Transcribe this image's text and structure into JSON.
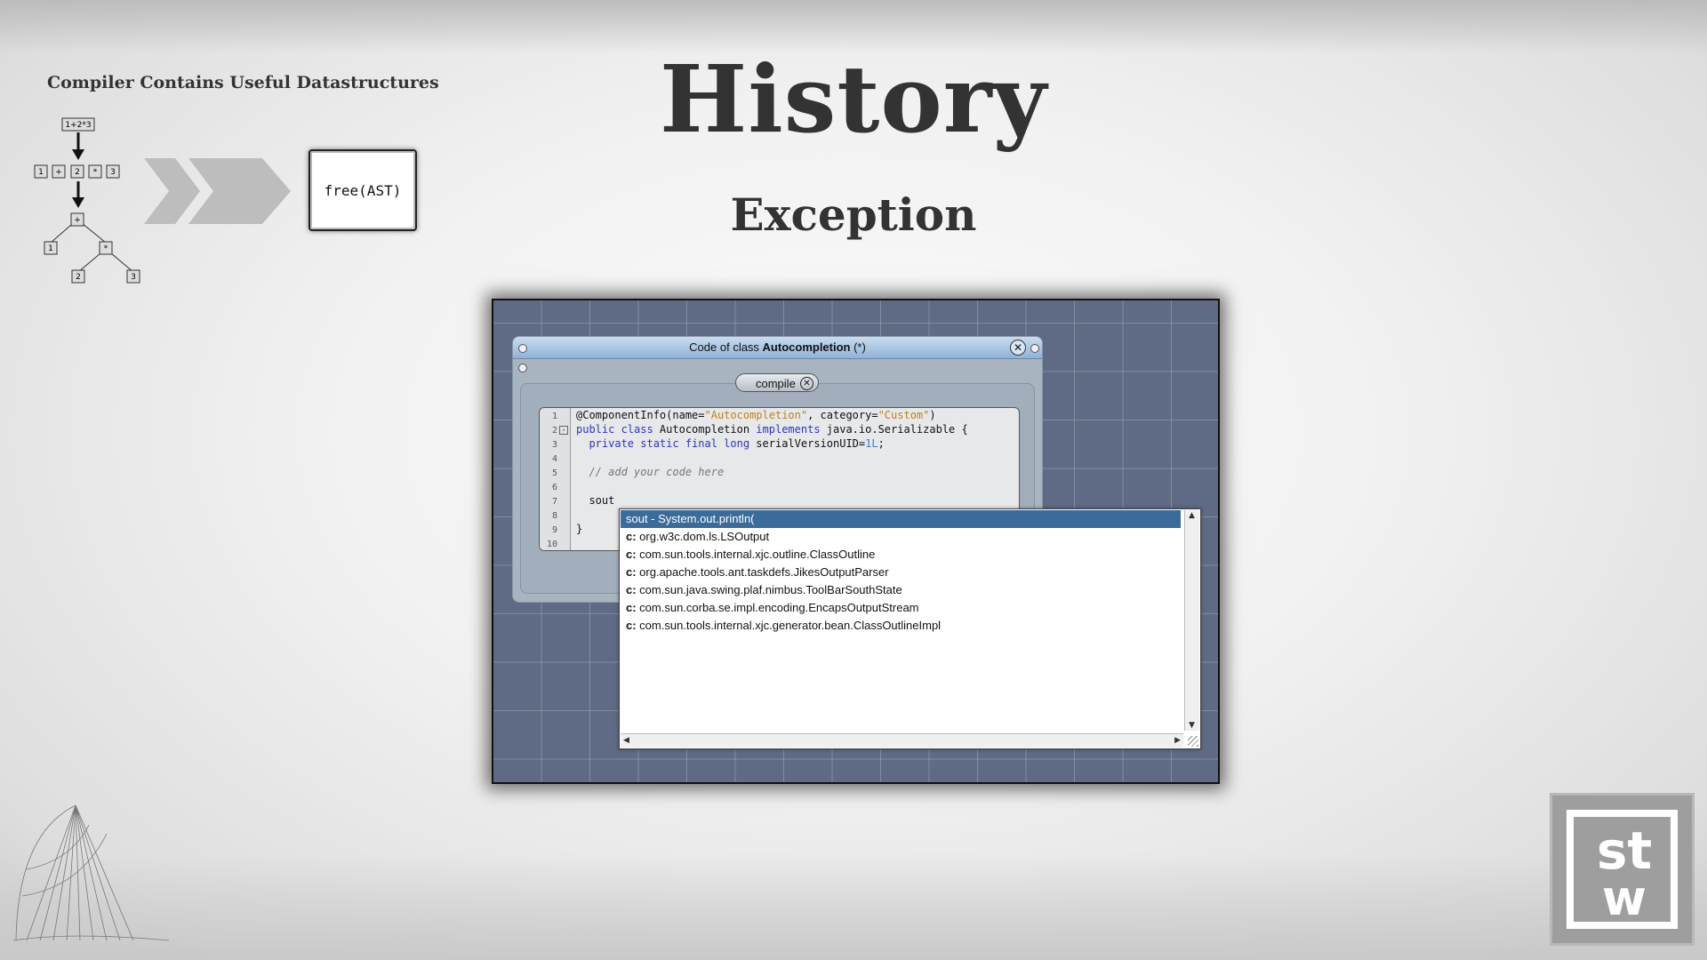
{
  "slide": {
    "title": "History",
    "subtitle": "Exception",
    "compiler": {
      "heading": "Compiler Contains Useful Datastructures",
      "expr": "1+2*3",
      "tokens": [
        "1",
        "+",
        "2",
        "*",
        "3"
      ],
      "tree": {
        "root": "+",
        "left": "1",
        "op": "*",
        "l2": "2",
        "r2": "3"
      },
      "result": "free(AST)"
    }
  },
  "window": {
    "title_prefix": "Code of class ",
    "title_class": "Autocompletion",
    "title_suffix": " (*)",
    "compile_label": "compile",
    "editor": {
      "line_numbers": [
        "1",
        "2",
        "3",
        "4",
        "5",
        "6",
        "7",
        "8",
        "9",
        "10"
      ],
      "lines": [
        "@ComponentInfo(name=\"Autocompletion\", category=\"Custom\")",
        "public class Autocompletion implements java.io.Serializable {",
        "  private static final long serialVersionUID=1L;",
        "",
        "  // add your code here",
        "",
        "  sout",
        "",
        "}",
        ""
      ]
    }
  },
  "autocomplete": {
    "items": [
      {
        "prefix": "",
        "text": "sout - System.out.println("
      },
      {
        "prefix": "c:",
        "text": " org.w3c.dom.ls.LSOutput"
      },
      {
        "prefix": "c:",
        "text": " com.sun.tools.internal.xjc.outline.ClassOutline"
      },
      {
        "prefix": "c:",
        "text": " org.apache.tools.ant.taskdefs.JikesOutputParser"
      },
      {
        "prefix": "c:",
        "text": " com.sun.java.swing.plaf.nimbus.ToolBarSouthState"
      },
      {
        "prefix": "c:",
        "text": " com.sun.corba.se.impl.encoding.EncapsOutputStream"
      },
      {
        "prefix": "c:",
        "text": " com.sun.tools.internal.xjc.generator.bean.ClassOutlineImpl"
      }
    ],
    "selected_index": 0,
    "colors": {
      "selection": "#3a6b99"
    }
  },
  "logo": {
    "letters": "st w"
  },
  "icons": [
    "close-icon",
    "scroll-up-icon",
    "scroll-down-icon",
    "scroll-left-icon",
    "scroll-right-icon",
    "resize-grip-icon",
    "chevron-right-icon"
  ]
}
